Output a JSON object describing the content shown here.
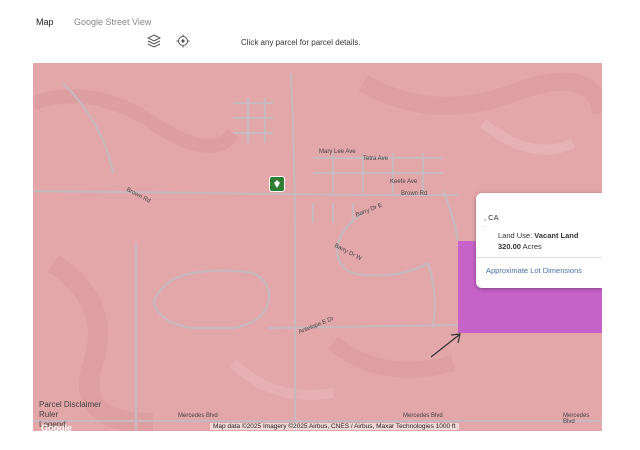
{
  "tabs": {
    "map": "Map",
    "street_view": "Google Street View"
  },
  "toolbar": {
    "layers_icon": "layers-icon",
    "locate_icon": "locate-icon",
    "hint": "Click any parcel for parcel details."
  },
  "map": {
    "road_labels": {
      "mary_lee": "Mary Lee Ave",
      "tetra": "Tetra Ave",
      "keefe": "Keefe Ave",
      "brown_w": "Brown Rd",
      "brown_e": "Brown Rd",
      "barry_e": "Barry Dr E",
      "barry_w": "Barry Dr W",
      "antelope_e": "Antelope E Dr",
      "mercedes_1": "Mercedes Blvd",
      "mercedes_2": "Mercedes Blvd",
      "mercedes_3": "Mercedes Blvd"
    },
    "popup": {
      "location": ", CA",
      "dot": "·",
      "land_use_label": "Land Use: ",
      "land_use_value": "Vacant Land",
      "acres_value": "320.00",
      "acres_unit": "Acres",
      "link": "Approximate Lot Dimensions"
    },
    "disclaimer": {
      "line1": "Parcel Disclaimer",
      "line2": "Ruler",
      "line3": "Legend"
    },
    "google_logo": "Google",
    "attribution": "Map data ©2025 Imagery ©2025 Airbus, CNES / Airbus, Maxar Technologies   1000 ft"
  }
}
